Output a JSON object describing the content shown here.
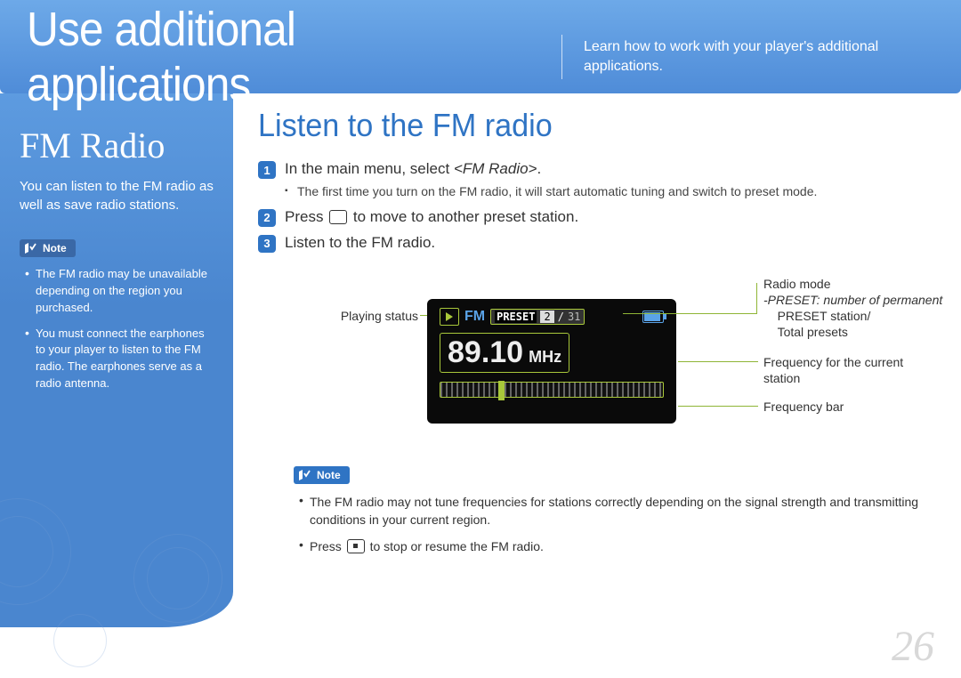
{
  "header": {
    "title": "Use additional applications",
    "subtitle": "Learn how to work with your player's additional applications."
  },
  "sidebar": {
    "title": "FM Radio",
    "intro": "You can listen to the FM radio as well as save radio stations.",
    "note_label": "Note",
    "notes": [
      "The FM radio may be unavailable depending on the region you purchased.",
      "You must connect the earphones to your player to listen to the FM radio. The earphones serve as a radio antenna."
    ]
  },
  "main": {
    "heading": "Listen to the FM radio",
    "steps": [
      {
        "num": "1",
        "text_pre": "In the main menu, select ",
        "text_em": "<FM Radio>",
        "text_post": ".",
        "sub": "The first time you turn on the FM radio, it will start automatic tuning and switch to preset mode."
      },
      {
        "num": "2",
        "text_pre": "Press ",
        "inline_icon": "nav-button",
        "text_post": " to move to another preset station."
      },
      {
        "num": "3",
        "text_pre": "Listen to the FM radio."
      }
    ],
    "diagram": {
      "playing_status_label": "Playing status",
      "fm_label": "FM",
      "preset_label": "PRESET",
      "preset_current": "2",
      "preset_sep": "/",
      "preset_total": "31",
      "frequency": "89.10",
      "unit": "MHz",
      "callout_radio_mode": "Radio mode",
      "callout_preset_line": "-PRESET: number of permanent",
      "callout_preset_line2": "PRESET station/",
      "callout_preset_line3": "Total presets",
      "callout_freq": "Frequency for the current station",
      "callout_bar": "Frequency bar"
    },
    "note_label": "Note",
    "bottom_notes": {
      "n1": "The FM radio may not tune frequencies for stations correctly depending on the signal strength and transmitting conditions in your current region.",
      "n2_pre": "Press ",
      "n2_post": " to stop or resume the FM radio."
    }
  },
  "page_number": "26"
}
